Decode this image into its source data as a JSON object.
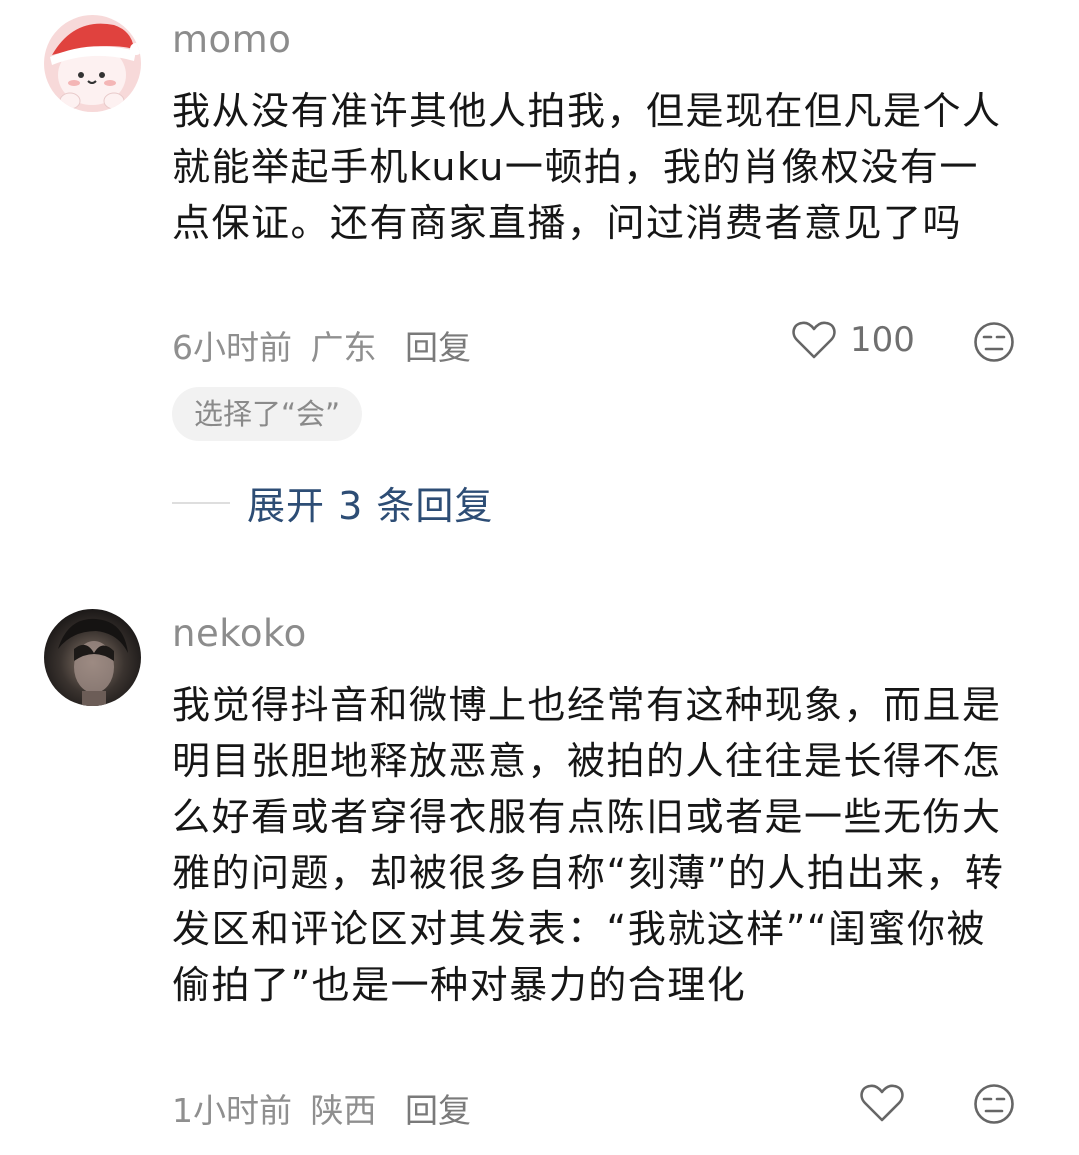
{
  "comments": [
    {
      "username": "momo",
      "text": "我从没有准许其他人拍我，但是现在但凡是个人就能举起手机kuku一顿拍，我的肖像权没有一点保证。还有商家直播，问过消费者意见了吗",
      "time": "6小时前",
      "location": "广东",
      "reply_label": "回复",
      "likes": "100",
      "tag": "选择了“会”",
      "expand_label": "展开 3 条回复",
      "avatar": "santa-hat-cartoon-avatar"
    },
    {
      "username": "nekoko",
      "text": "我觉得抖音和微博上也经常有这种现象，而且是明目张胆地释放恶意，被拍的人往往是长得不怎么好看或者穿得衣服有点陈旧或者是一些无伤大雅的问题，却被很多自称“刻薄”的人拍出来，转发区和评论区对其发表：“我就这样”“闺蜜你被偷拍了”也是一种对暴力的合理化",
      "time": "1小时前",
      "location": "陕西",
      "reply_label": "回复",
      "avatar": "dark-photo-avatar"
    }
  ],
  "icons": {
    "like": "heart-outline-icon",
    "dislike": "unamused-face-icon"
  },
  "colors": {
    "username": "#8c8c8c",
    "meta": "#8f8f8f",
    "expand": "#2d4d75",
    "pill_bg": "#f2f2f2"
  }
}
